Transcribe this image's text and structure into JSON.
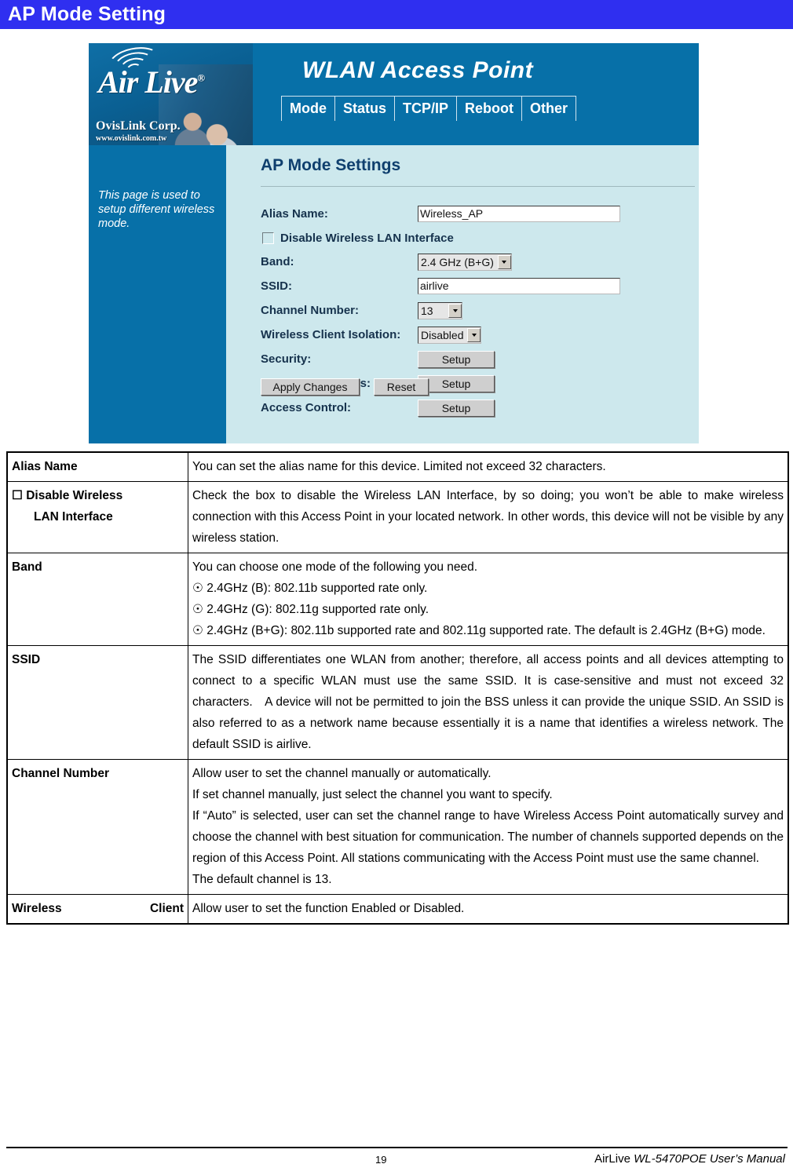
{
  "banner": {
    "title": "AP Mode Setting"
  },
  "screenshot": {
    "logo": {
      "brand": "Air Live",
      "registered": "®",
      "company": "OvisLink Corp.",
      "url": "www.ovislink.com.tw"
    },
    "product_title": "WLAN Access Point",
    "nav_tabs": [
      {
        "label": "Mode"
      },
      {
        "label": "Status"
      },
      {
        "label": "TCP/IP"
      },
      {
        "label": "Reboot"
      },
      {
        "label": "Other"
      }
    ],
    "sidebar": {
      "help_text": "This page is used to setup different wireless mode."
    },
    "panel_title": "AP Mode Settings",
    "fields": {
      "alias_name": {
        "label": "Alias Name:",
        "value": "Wireless_AP"
      },
      "disable_wlan": {
        "label": "Disable Wireless LAN Interface",
        "checked": false
      },
      "band": {
        "label": "Band:",
        "value": "2.4 GHz (B+G)"
      },
      "ssid": {
        "label": "SSID:",
        "value": "airlive"
      },
      "channel_number": {
        "label": "Channel Number:",
        "value": "13"
      },
      "client_isolation": {
        "label": "Wireless Client Isolation:",
        "value": "Disabled"
      },
      "security": {
        "label": "Security:",
        "button": "Setup"
      },
      "advanced_settings": {
        "label": "Advanced Settings:",
        "button": "Setup"
      },
      "access_control": {
        "label": "Access Control:",
        "button": "Setup"
      }
    },
    "buttons": {
      "apply": "Apply Changes",
      "reset": "Reset"
    },
    "colors": {
      "header_blue": "#0770a8",
      "panel_bg": "#cde8ed",
      "banner_blue": "#2f2ff0",
      "title_navy": "#0f3f6e"
    }
  },
  "table": {
    "rows": [
      {
        "label": "Alias Name",
        "desc": "You can set the alias name for this device. Limited not exceed 32 characters."
      },
      {
        "label_checkbox": "☐",
        "label_line1": "Disable Wireless",
        "label_line2": "LAN Interface",
        "desc": "Check the box to disable the Wireless LAN Interface, by so doing; you won’t be able to make wireless connection with this Access Point in your located network. In other words, this device will not be visible by any wireless station."
      },
      {
        "label": "Band",
        "desc_lines": [
          "You can choose one mode of the following you need.",
          "☉ 2.4GHz (B): 802.11b supported rate only.",
          "☉ 2.4GHz (G): 802.11g supported rate only.",
          "☉ 2.4GHz (B+G): 802.11b supported rate and 802.11g supported rate. The default is 2.4GHz (B+G) mode."
        ]
      },
      {
        "label": "SSID",
        "desc": "The SSID differentiates one WLAN from another; therefore, all access points and all devices attempting to connect to a specific WLAN must use the same SSID. It is case-sensitive and must not exceed 32 characters. A device will not be permitted to join the BSS unless it can provide the unique SSID. An SSID is also referred to as a network name because essentially it is a name that identifies a wireless network. The default SSID is airlive."
      },
      {
        "label": "Channel Number",
        "desc_lines": [
          "Allow user to set the channel manually or automatically.",
          "If set channel manually, just select the channel you want to specify.",
          "If “Auto” is selected, user can set the channel range to have Wireless Access Point automatically survey and choose the channel with best situation for communication. The number of channels supported depends on the region of this Access Point. All stations communicating with the Access Point must use the same channel.",
          "The default channel is 13."
        ]
      },
      {
        "label_left": "Wireless",
        "label_right": "Client",
        "desc": "Allow user to set the function Enabled or Disabled."
      }
    ]
  },
  "footer": {
    "page_number": "19",
    "manual_prefix": "AirLive ",
    "manual_title": "WL-5470POE User’s Manual"
  }
}
